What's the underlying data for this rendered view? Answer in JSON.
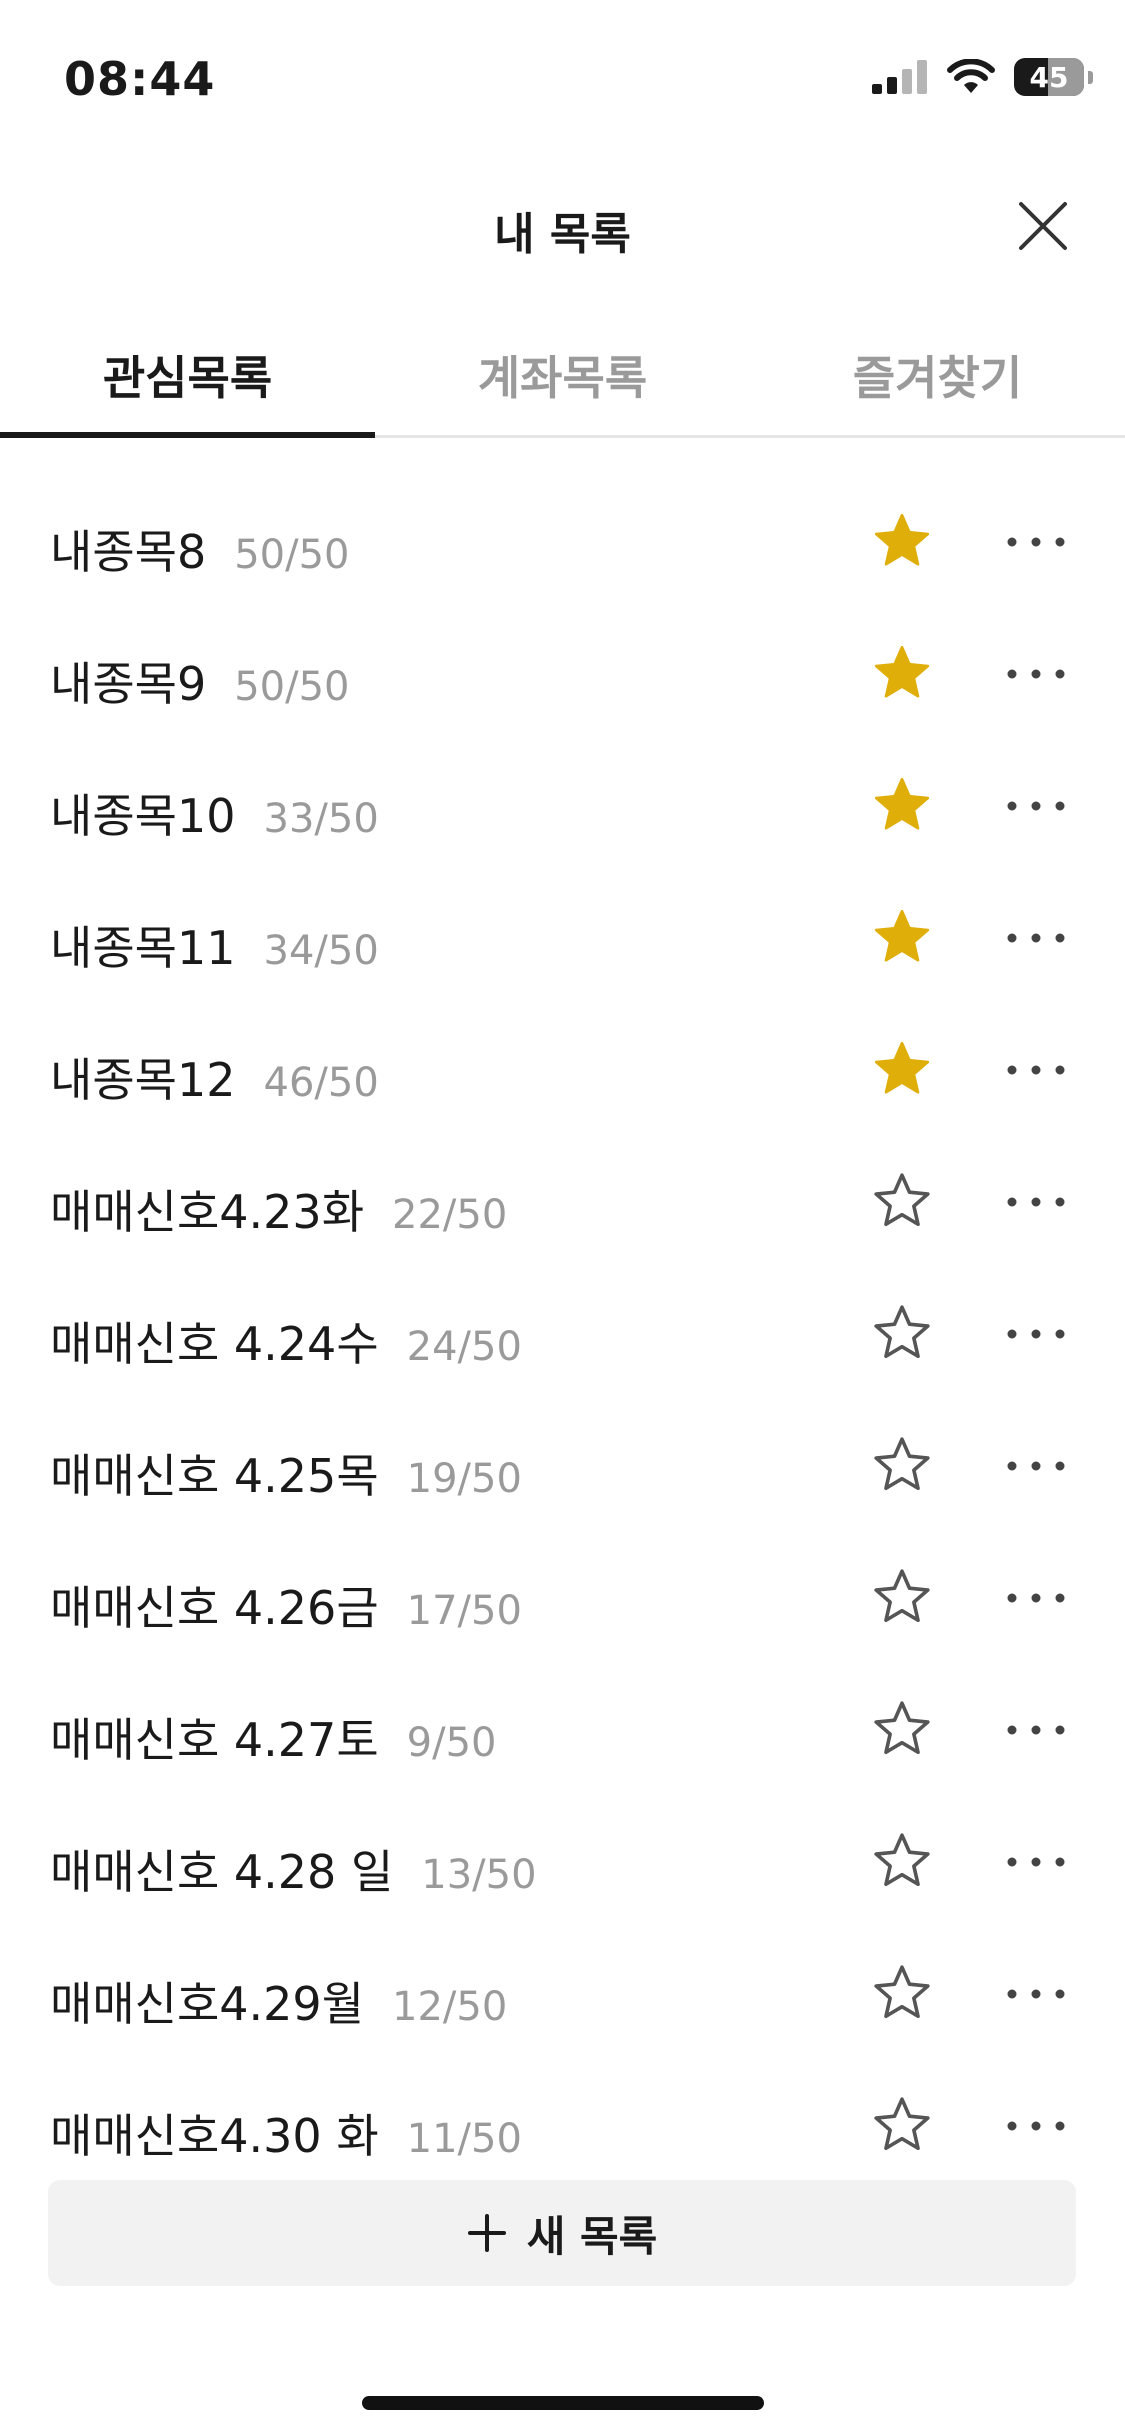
{
  "status_bar": {
    "time": "08:44",
    "battery": "45",
    "icons": [
      "cellular-signal-icon",
      "wifi-icon",
      "battery-icon"
    ]
  },
  "header": {
    "title": "내 목록",
    "close_icon": "close-icon"
  },
  "tabs": [
    {
      "label": "관심목록",
      "active": true
    },
    {
      "label": "계좌목록",
      "active": false
    },
    {
      "label": "즐겨찾기",
      "active": false
    }
  ],
  "list": {
    "items": [
      {
        "name": "내종목8",
        "count": "50/50",
        "favorite": true
      },
      {
        "name": "내종목9",
        "count": "50/50",
        "favorite": true
      },
      {
        "name": "내종목10",
        "count": "33/50",
        "favorite": true
      },
      {
        "name": "내종목11",
        "count": "34/50",
        "favorite": true
      },
      {
        "name": "내종목12",
        "count": "46/50",
        "favorite": true
      },
      {
        "name": "매매신호4.23화",
        "count": "22/50",
        "favorite": false
      },
      {
        "name": "매매신호 4.24수",
        "count": "24/50",
        "favorite": false
      },
      {
        "name": "매매신호 4.25목",
        "count": "19/50",
        "favorite": false
      },
      {
        "name": "매매신호 4.26금",
        "count": "17/50",
        "favorite": false
      },
      {
        "name": "매매신호 4.27토",
        "count": "9/50",
        "favorite": false
      },
      {
        "name": "매매신호 4.28 일",
        "count": "13/50",
        "favorite": false
      },
      {
        "name": "매매신호4.29월",
        "count": "12/50",
        "favorite": false
      },
      {
        "name": "매매신호4.30 화",
        "count": "11/50",
        "favorite": false
      }
    ]
  },
  "new_list_button": {
    "label": "새 목록",
    "icon": "plus-icon"
  },
  "colors": {
    "star_filled": "#DFAE08",
    "star_outline": "#555555",
    "muted_text": "#9A9A9A",
    "button_bg": "#F2F2F2"
  }
}
